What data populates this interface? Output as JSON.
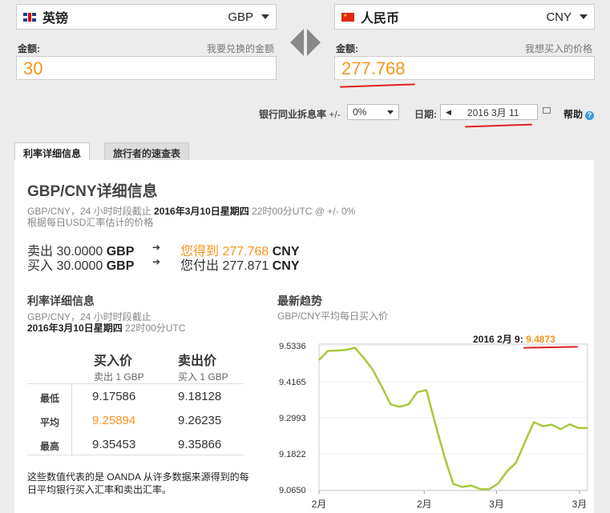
{
  "from_currency": {
    "name": "英镑",
    "code": "GBP"
  },
  "to_currency": {
    "name": "人民币",
    "code": "CNY"
  },
  "amount_from": {
    "label": "金额:",
    "hint": "我要兑换的金额",
    "value": "30"
  },
  "amount_to": {
    "label": "金额:",
    "hint": "我想买入的价格",
    "value": "277.768"
  },
  "options": {
    "interbank_label": "银行同业拆息率",
    "interbank_prefix": "+/-",
    "interbank_value": "0%",
    "date_label": "日期:",
    "date_value": "2016 3月 11",
    "help_label": "帮助"
  },
  "tabs": [
    "利率详细信息",
    "旅行者的速查表"
  ],
  "details": {
    "title": "GBP/CNY详细信息",
    "meta_prefix": "GBP/CNY，24 小时时段截止 ",
    "meta_date": "2016年3月10日星期四",
    "meta_suffix": " 22时00分UTC @ +/- 0%",
    "meta_line2": "根据每日USD汇率估计的价格",
    "sell_line": {
      "left_prefix": "卖出 30.0000 ",
      "left_code": "GBP",
      "right_prefix": "您得到 277.768 ",
      "right_code": "CNY"
    },
    "buy_line": {
      "left_prefix": "买入 30.0000 ",
      "left_code": "GBP",
      "right_prefix": "您付出 277.871 ",
      "right_code": "CNY"
    },
    "arrow": "➔"
  },
  "rate_info": {
    "title": "利率详细信息",
    "meta1": "GBP/CNY，24 小时时段截止",
    "meta2_bold": "2016年3月10日星期四",
    "meta2_rest": " 22时00分UTC",
    "col_buy": "买入价",
    "col_sell": "卖出价",
    "sub_buy": "卖出 1 GBP",
    "sub_sell": "买入 1 GBP",
    "rows": [
      {
        "label": "最低",
        "buy": "9.17586",
        "sell": "9.18128"
      },
      {
        "label": "平均",
        "buy": "9.25894",
        "sell": "9.26235"
      },
      {
        "label": "最高",
        "buy": "9.35453",
        "sell": "9.35866"
      }
    ],
    "note": "这些数值代表的是 OANDA 从许多数据来源得到的每日平均银行买入汇率和卖出汇率。"
  },
  "trend": {
    "title": "最新趋势",
    "subtitle": "GBP/CNY平均每日买入价",
    "tooltip_label": "2016 2月 9:",
    "tooltip_value": "9.4873"
  },
  "chart_data": {
    "type": "line",
    "yticks": [
      "9.5336",
      "9.4165",
      "9.2993",
      "9.1822",
      "9.0650"
    ],
    "ylim": [
      9.065,
      9.5336
    ],
    "xticks": [
      "2月",
      "2月",
      "3月",
      "3月"
    ],
    "xtick_positions": [
      0.0,
      0.392,
      0.661,
      0.97
    ],
    "line_color": "#a8c83c",
    "series": [
      {
        "values": [
          9.487,
          9.517,
          9.518,
          9.52,
          9.527,
          9.494,
          9.456,
          9.401,
          9.343,
          9.335,
          9.343,
          9.383,
          9.389,
          9.278,
          9.174,
          9.084,
          9.074,
          9.079,
          9.067,
          9.067,
          9.085,
          9.125,
          9.153,
          9.22,
          9.285,
          9.272,
          9.277,
          9.262,
          9.278,
          9.266,
          9.266
        ]
      }
    ]
  }
}
